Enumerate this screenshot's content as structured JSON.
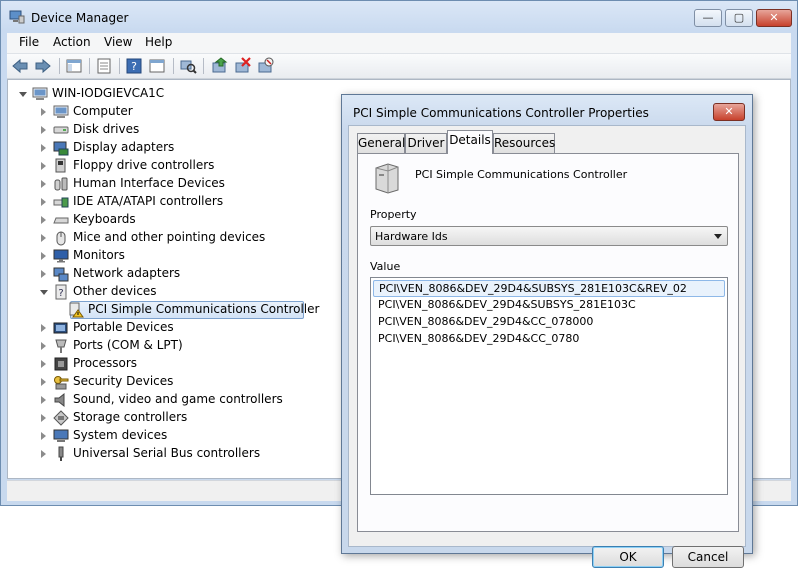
{
  "window": {
    "title": "Device Manager",
    "controls": {
      "minimize": "—",
      "maximize": "▢",
      "close": "✕"
    }
  },
  "menu": [
    "File",
    "Action",
    "View",
    "Help"
  ],
  "toolbar": [
    "back-icon",
    "forward-icon",
    "show-hide-console-tree-icon",
    "properties-icon",
    "help-icon",
    "scan-hardware-icon",
    "update-driver-icon",
    "uninstall-icon",
    "disable-icon"
  ],
  "tree": {
    "root": "WIN-IODGIEVCA1C",
    "items": [
      {
        "label": "Computer",
        "icon": "computer-icon"
      },
      {
        "label": "Disk drives",
        "icon": "disk-drive-icon"
      },
      {
        "label": "Display adapters",
        "icon": "display-adapter-icon"
      },
      {
        "label": "Floppy drive controllers",
        "icon": "floppy-controller-icon"
      },
      {
        "label": "Human Interface Devices",
        "icon": "hid-icon"
      },
      {
        "label": "IDE ATA/ATAPI controllers",
        "icon": "ide-controller-icon"
      },
      {
        "label": "Keyboards",
        "icon": "keyboard-icon"
      },
      {
        "label": "Mice and other pointing devices",
        "icon": "mouse-icon"
      },
      {
        "label": "Monitors",
        "icon": "monitor-icon"
      },
      {
        "label": "Network adapters",
        "icon": "network-adapter-icon"
      },
      {
        "label": "Other devices",
        "icon": "other-devices-icon"
      },
      {
        "label": "PCI Simple Communications Controller",
        "icon": "unknown-device-warning-icon"
      },
      {
        "label": "Portable Devices",
        "icon": "portable-device-icon"
      },
      {
        "label": "Ports (COM & LPT)",
        "icon": "port-icon"
      },
      {
        "label": "Processors",
        "icon": "processor-icon"
      },
      {
        "label": "Security Devices",
        "icon": "security-device-icon"
      },
      {
        "label": "Sound, video and game controllers",
        "icon": "sound-icon"
      },
      {
        "label": "Storage controllers",
        "icon": "storage-controller-icon"
      },
      {
        "label": "System devices",
        "icon": "system-device-icon"
      },
      {
        "label": "Universal Serial Bus controllers",
        "icon": "usb-icon"
      }
    ]
  },
  "dialog": {
    "title": "PCI Simple Communications Controller Properties",
    "close": "✕",
    "tabs": [
      "General",
      "Driver",
      "Details",
      "Resources"
    ],
    "active_tab": "Details",
    "device_name": "PCI Simple Communications Controller",
    "property_label": "Property",
    "property_value": "Hardware Ids",
    "value_label": "Value",
    "values": [
      "PCI\\VEN_8086&DEV_29D4&SUBSYS_281E103C&REV_02",
      "PCI\\VEN_8086&DEV_29D4&SUBSYS_281E103C",
      "PCI\\VEN_8086&DEV_29D4&CC_078000",
      "PCI\\VEN_8086&DEV_29D4&CC_0780"
    ],
    "ok": "OK",
    "cancel": "Cancel"
  }
}
